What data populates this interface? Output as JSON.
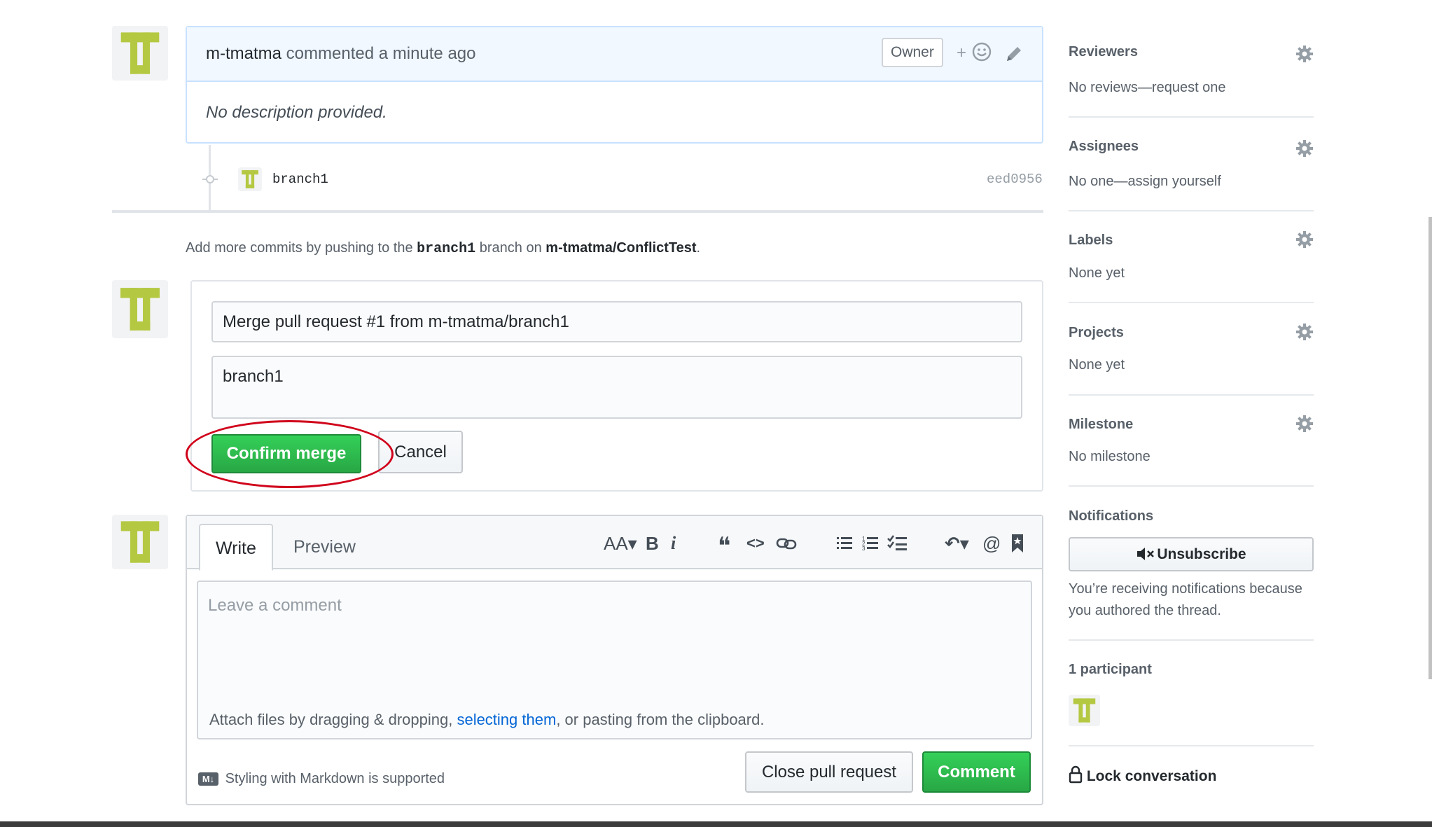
{
  "comment": {
    "author": "m-tmatma",
    "meta": "commented a minute ago",
    "badge": "Owner",
    "reaction_plus": "+",
    "body": "No description provided."
  },
  "commit": {
    "message": "branch1",
    "sha": "eed0956"
  },
  "info": {
    "prefix": "Add more commits by pushing to the",
    "branch": "branch1",
    "middle": "branch on",
    "repo": "m-tmatma/ConflictTest",
    "suffix": "."
  },
  "merge": {
    "title_value": "Merge pull request #1 from m-tmatma/branch1",
    "message_value": "branch1",
    "confirm_label": "Confirm merge",
    "cancel_label": "Cancel"
  },
  "composer": {
    "tab_write": "Write",
    "tab_preview": "Preview",
    "placeholder": "Leave a comment",
    "attach_prefix": "Attach files by dragging & dropping,",
    "attach_link": "selecting them",
    "attach_suffix": ", or pasting from the clipboard.",
    "markdown_note": "Styling with Markdown is supported",
    "markdown_badge": "M↓",
    "close_label": "Close pull request",
    "comment_label": "Comment",
    "toolbar": {
      "heading": "AA▾",
      "bold": "B",
      "italic": "i",
      "quote": "❝",
      "code": "<>",
      "link": "🔗",
      "ul": "☰",
      "ol": "☰",
      "tasks": "☑",
      "reply": "↶▾",
      "mention": "@",
      "bookmark": "🔖"
    }
  },
  "sidebar": {
    "reviewers": {
      "heading": "Reviewers",
      "value": "No reviews—request one"
    },
    "assignees": {
      "heading": "Assignees",
      "value": "No one—assign yourself"
    },
    "labels": {
      "heading": "Labels",
      "value": "None yet"
    },
    "projects": {
      "heading": "Projects",
      "value": "None yet"
    },
    "milestone": {
      "heading": "Milestone",
      "value": "No milestone"
    },
    "notifications": {
      "heading": "Notifications",
      "button": "Unsubscribe",
      "reason_line1": "You’re receiving notifications because",
      "reason_line2": "you authored the thread."
    },
    "participants": {
      "heading": "1 participant"
    },
    "lock": "Lock conversation"
  },
  "colors": {
    "avatar": "#b5c842",
    "accent_green": "#28a745",
    "annotation_red": "#d0021b",
    "link_blue": "#0366d6"
  },
  "icons": {
    "gear": "gear-icon",
    "smiley": "smiley-icon",
    "pencil": "pencil-icon",
    "mute": "mute-icon",
    "lock": "lock-icon",
    "markdown": "markdown-icon",
    "commit": "commit-icon"
  }
}
